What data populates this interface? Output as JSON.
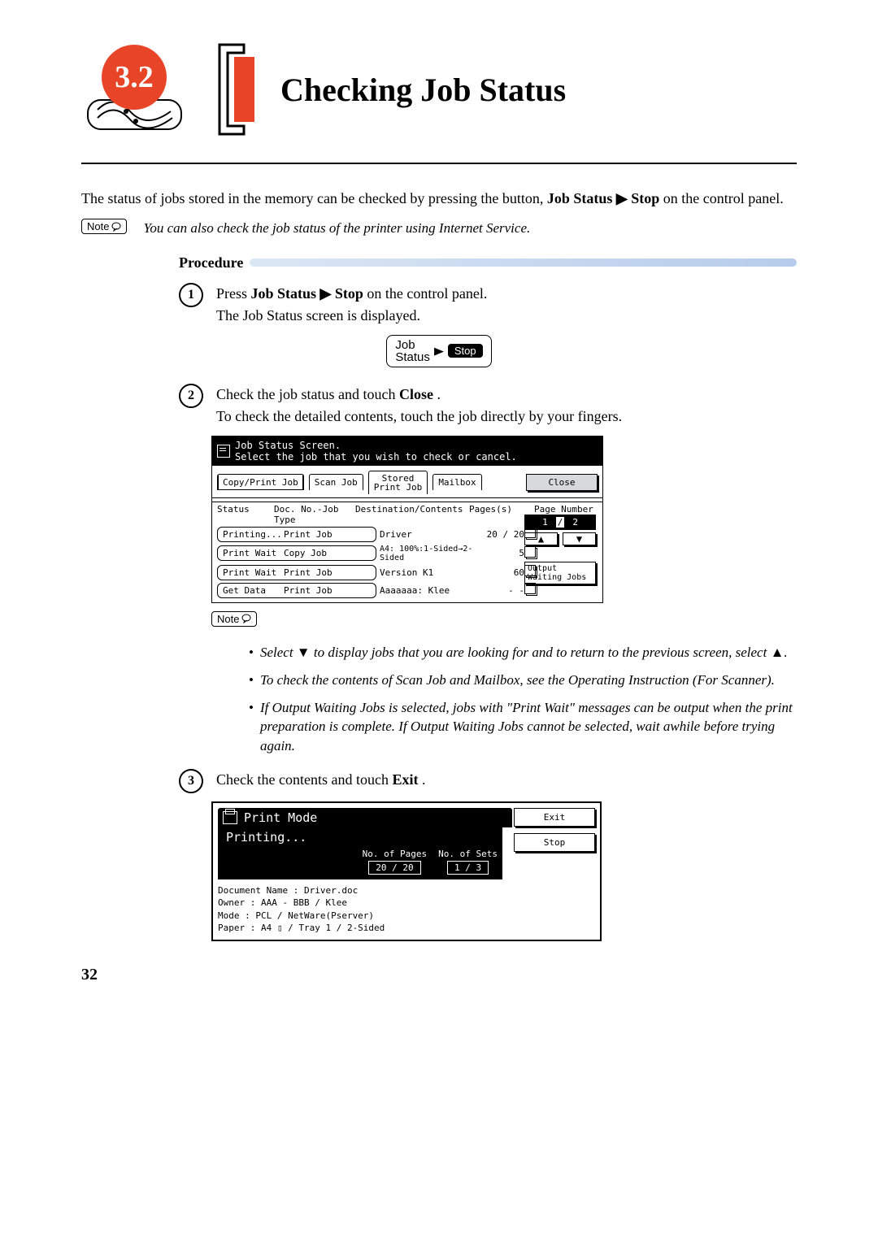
{
  "section_number": "3.2",
  "page_title": "Checking Job Status",
  "intro_pre": "The status of jobs stored in the memory can be checked by pressing the button, ",
  "intro_keyword": "Job Status ▶ Stop",
  "intro_post": " on the control panel.",
  "note_label": "Note",
  "top_note": "You can also check the job status of the printer using Internet Service.",
  "procedure_label": "Procedure",
  "steps": {
    "s1": {
      "num": "1",
      "line1_pre": "Press ",
      "line1_strong": "Job Status ▶ Stop",
      "line1_post": " on the control panel.",
      "line2": "The Job Status screen is displayed."
    },
    "s2": {
      "num": "2",
      "line1_pre": "Check the job status and touch ",
      "line1_strong": "Close",
      "line1_post": ".",
      "line2": "To check the detailed contents, touch the job directly by your fingers."
    },
    "s3": {
      "num": "3",
      "line_pre": "Check the contents and touch ",
      "line_strong": "Exit",
      "line_post": "."
    }
  },
  "button_graphic": {
    "l1": "Job",
    "l2": "Status",
    "stop": "Stop"
  },
  "job_screen": {
    "title": "Job Status Screen.",
    "subtitle": "Select the job that you wish to check or cancel.",
    "tabs": {
      "copyprint": "Copy/Print Job",
      "scan": "Scan Job",
      "stored1": "Stored",
      "stored2": "Print Job",
      "mailbox": "Mailbox"
    },
    "close": "Close",
    "headers": {
      "status": "Status",
      "doc": "Doc. No.-Job Type",
      "dest": "Destination/Contents",
      "pages": "Pages(s)",
      "pagenum": "Page Number"
    },
    "rows": [
      {
        "status": "Printing...",
        "type": "Print Job",
        "dest": "Driver",
        "pages": "20 / 20"
      },
      {
        "status": "Print Wait",
        "type": "Copy Job",
        "dest": "A4: 100%:1-Sided→2-Sided",
        "pages": "5"
      },
      {
        "status": "Print Wait",
        "type": "Print Job",
        "dest": "Version K1",
        "pages": "60"
      },
      {
        "status": "Get Data",
        "type": "Print Job",
        "dest": "Aaaaaaa: Klee",
        "pages": "- -"
      }
    ],
    "page_ind": {
      "cur": "1",
      "tot": "2"
    },
    "up": "▲",
    "down": "▼",
    "output1": "Output",
    "output2": "Waiting Jobs"
  },
  "bullets": {
    "b1": "Select ▼ to display jobs that you are looking for and to return to the previous screen, select ▲.",
    "b2": "To check the contents of Scan Job and Mailbox, see the Operating Instruction (For Scanner).",
    "b3": "If Output Waiting Jobs is selected, jobs with \"Print Wait\" messages can be output when the print preparation is complete. If Output Waiting Jobs cannot be selected, wait awhile before trying again."
  },
  "print_mode": {
    "title": "Print Mode",
    "status": "Printing...",
    "pages_label": "No. of Pages",
    "sets_label": "No. of Sets",
    "pages_val": "20 / 20",
    "sets_val": "1 / 3",
    "exit": "Exit",
    "stop": "Stop",
    "d1": "Document Name : Driver.doc",
    "d2": "Owner         : AAA - BBB / Klee",
    "d3": "Mode          : PCL / NetWare(Pserver)",
    "d4": "Paper         : A4 ▯ / Tray 1 /  2-Sided"
  },
  "page_number": "32"
}
